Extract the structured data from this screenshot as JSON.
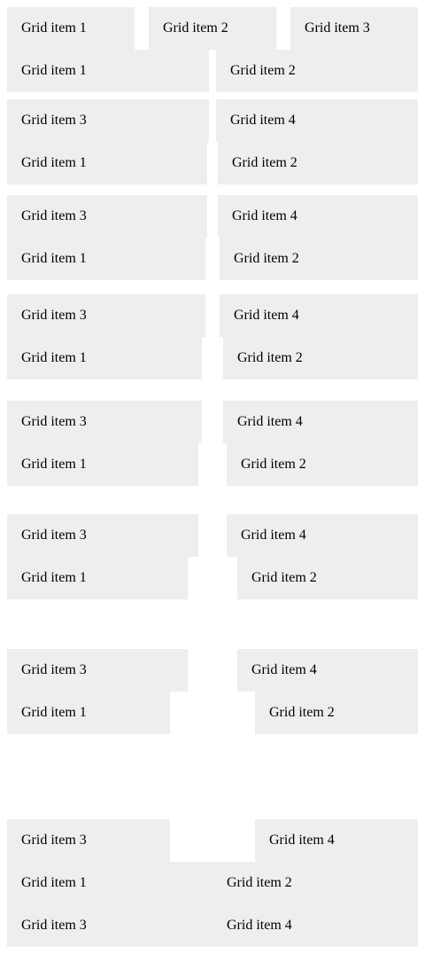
{
  "row1": [
    "Grid item 1",
    "Grid item 2",
    "Grid item 3"
  ],
  "groups": [
    [
      "Grid item 1",
      "Grid item 2",
      "Grid item 3",
      "Grid item 4"
    ],
    [
      "Grid item 1",
      "Grid item 2",
      "Grid item 3",
      "Grid item 4"
    ],
    [
      "Grid item 1",
      "Grid item 2",
      "Grid item 3",
      "Grid item 4"
    ],
    [
      "Grid item 1",
      "Grid item 2",
      "Grid item 3",
      "Grid item 4"
    ],
    [
      "Grid item 1",
      "Grid item 2",
      "Grid item 3",
      "Grid item 4"
    ],
    [
      "Grid item 1",
      "Grid item 2",
      "Grid item 3",
      "Grid item 4"
    ],
    [
      "Grid item 1",
      "Grid item 2",
      "Grid item 3",
      "Grid item 4"
    ],
    [
      "Grid item 1",
      "Grid item 2",
      "Grid item 3",
      "Grid item 4"
    ]
  ],
  "colors": {
    "item_background": "#eeeeee",
    "page_background": "#ffffff",
    "text": "#000000"
  }
}
